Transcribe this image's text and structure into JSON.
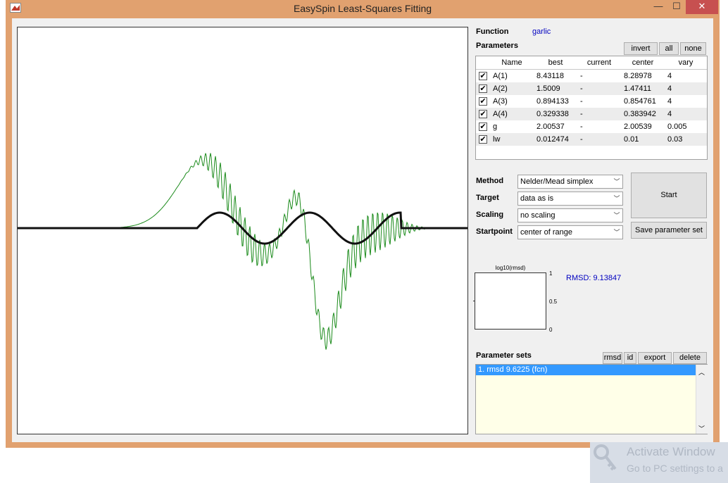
{
  "window": {
    "title": "EasySpin Least-Squares Fitting",
    "controls": {
      "minimize": "—",
      "maximize": "☐",
      "close": "✕"
    }
  },
  "plot": {
    "lines": [
      {
        "name": "",
        "color": "#1a8a1a"
      },
      {
        "name": "",
        "color": "#111111"
      }
    ]
  },
  "function": {
    "label": "Function",
    "value": "garlic"
  },
  "parameters": {
    "label": "Parameters",
    "buttons": {
      "invert": "invert",
      "all": "all",
      "none": "none"
    },
    "columns": [
      "",
      "Name",
      "best",
      "current",
      "center",
      "vary"
    ],
    "rows": [
      {
        "checked": true,
        "name": "A(1)",
        "best": "8.43118",
        "current": "-",
        "center": "8.28978",
        "vary": "4"
      },
      {
        "checked": true,
        "name": "A(2)",
        "best": "1.5009",
        "current": "-",
        "center": "1.47411",
        "vary": "4"
      },
      {
        "checked": true,
        "name": "A(3)",
        "best": "0.894133",
        "current": "-",
        "center": "0.854761",
        "vary": "4"
      },
      {
        "checked": true,
        "name": "A(4)",
        "best": "0.329338",
        "current": "-",
        "center": "0.383942",
        "vary": "4"
      },
      {
        "checked": true,
        "name": "g",
        "best": "2.00537",
        "current": "-",
        "center": "2.00539",
        "vary": "0.005"
      },
      {
        "checked": true,
        "name": "lw",
        "best": "0.012474",
        "current": "-",
        "center": "0.01",
        "vary": "0.03"
      }
    ]
  },
  "settings": {
    "method": {
      "label": "Method",
      "value": "Nelder/Mead simplex"
    },
    "target": {
      "label": "Target",
      "value": "data as is"
    },
    "scaling": {
      "label": "Scaling",
      "value": "no scaling"
    },
    "startpoint": {
      "label": "Startpoint",
      "value": "center of range"
    }
  },
  "actions": {
    "start": "Start",
    "save": "Save parameter set"
  },
  "rmsd_plot": {
    "title": "log10(rmsd)",
    "ticks": [
      "1",
      "0.5",
      "0"
    ],
    "rmsd_text": "RMSD: 9.13847"
  },
  "parameter_sets": {
    "label": "Parameter sets",
    "buttons": {
      "rmsd": "rmsd",
      "id": "id",
      "export": "export",
      "delete": "delete"
    },
    "items": [
      "1. rmsd 9.6225 (fcn)"
    ]
  },
  "watermark": {
    "line1": "Activate Window",
    "line2": "Go to PC settings to a"
  },
  "colors": {
    "accent": "#3399ff",
    "frame": "#e1a16f",
    "link": "#0000c0",
    "close": "#c75050"
  }
}
